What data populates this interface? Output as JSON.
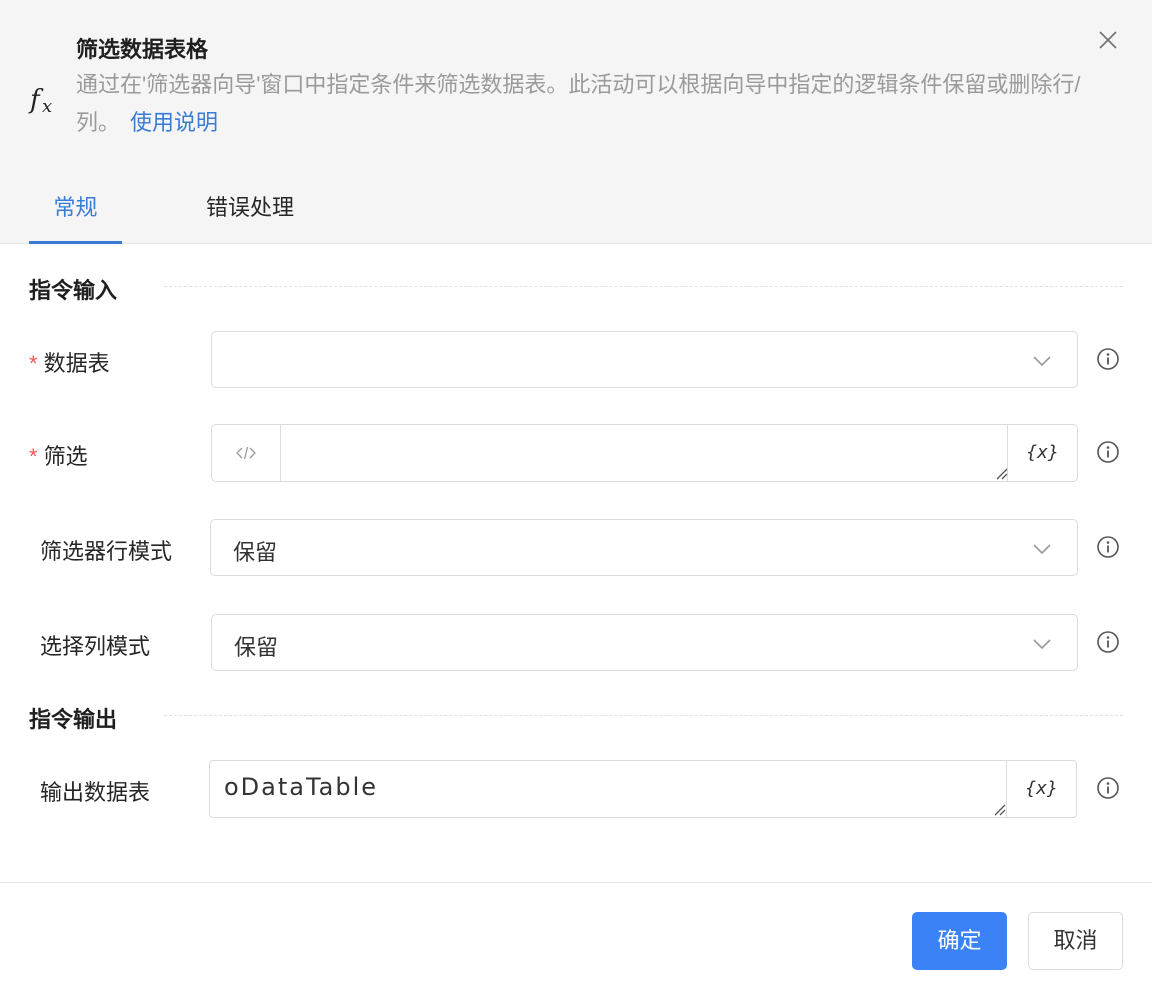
{
  "dialog": {
    "title": "筛选数据表格",
    "description": "通过在'筛选器向导'窗口中指定条件来筛选数据表。此活动可以根据向导中指定的逻辑条件保留或删除行/列。",
    "help_link": "使用说明",
    "close_icon": "close-icon",
    "fx_icon": "fx-icon"
  },
  "tabs": [
    {
      "label": "常规",
      "active": true
    },
    {
      "label": "错误处理",
      "active": false
    }
  ],
  "sections": {
    "input": "指令输入",
    "output": "指令输出"
  },
  "fields": {
    "data_table": {
      "label": "数据表",
      "required": true,
      "value": ""
    },
    "filter": {
      "label": "筛选",
      "required": true,
      "value": "",
      "prefix_icon": "code-icon",
      "var_label": "{x}"
    },
    "row_mode": {
      "label": "筛选器行模式",
      "value": "保留"
    },
    "column_mode": {
      "label": "选择列模式",
      "value": "保留"
    },
    "output_table": {
      "label": "输出数据表",
      "value": "oDataTable",
      "var_label": "{x}"
    }
  },
  "required_mark": "*",
  "buttons": {
    "ok": "确定",
    "cancel": "取消"
  },
  "colors": {
    "accent": "#3a7bd5",
    "primary_button": "#3b82f6",
    "required": "#f5555b"
  }
}
